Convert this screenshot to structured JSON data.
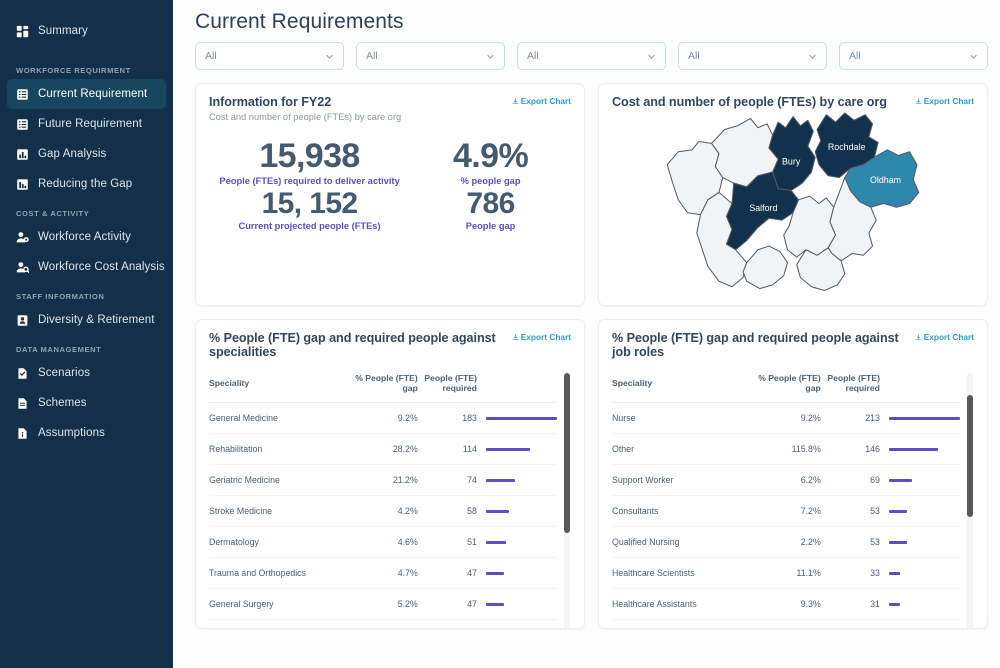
{
  "sidebar": {
    "items": [
      {
        "label": "Summary",
        "icon": "dashboard-icon",
        "type": "item",
        "active": false
      },
      {
        "label": "WORKFORCE REQUIRMENT",
        "type": "section"
      },
      {
        "label": "Current Requirement",
        "icon": "list-table-icon",
        "type": "item",
        "active": true
      },
      {
        "label": "Future Requirement",
        "icon": "list-table-icon",
        "type": "item",
        "active": false
      },
      {
        "label": "Gap Analysis",
        "icon": "chart-bar-icon",
        "type": "item",
        "active": false
      },
      {
        "label": "Reducing the Gap",
        "icon": "chart-decline-icon",
        "type": "item",
        "active": false
      },
      {
        "label": "COST &  ACTIVITY",
        "type": "section"
      },
      {
        "label": "Workforce Activity",
        "icon": "user-gear-icon",
        "type": "item",
        "active": false
      },
      {
        "label": "Workforce Cost Analysis",
        "icon": "user-search-icon",
        "type": "item",
        "active": false
      },
      {
        "label": "STAFF INFORMATION",
        "type": "section"
      },
      {
        "label": "Diversity & Retirement",
        "icon": "id-badge-icon",
        "type": "item",
        "active": false
      },
      {
        "label": "DATA MANAGEMENT",
        "type": "section"
      },
      {
        "label": "Scenarios",
        "icon": "file-check-icon",
        "type": "item",
        "active": false
      },
      {
        "label": "Schemes",
        "icon": "file-lines-icon",
        "type": "item",
        "active": false
      },
      {
        "label": "Assumptions",
        "icon": "file-info-icon",
        "type": "item",
        "active": false
      }
    ]
  },
  "header": {
    "title": "Current Requirements",
    "filters": [
      {
        "value": "All"
      },
      {
        "value": "All"
      },
      {
        "value": "All"
      },
      {
        "value": "All"
      },
      {
        "value": "All"
      }
    ]
  },
  "cards": {
    "info": {
      "title": "Information for FY22",
      "subtitle": "Cost and number of people (FTEs) by care org",
      "export_label": "Export Chart",
      "kpis": [
        {
          "value": "15,938",
          "label": "People (FTEs) required to deliver activity"
        },
        {
          "value": "4.9%",
          "label": "% people gap"
        },
        {
          "value": "15, 152",
          "label": "Current projected people (FTEs)"
        },
        {
          "value": "786",
          "label": "People gap"
        }
      ]
    },
    "map": {
      "title": "Cost and number of people (FTEs) by care org",
      "export_label": "Export Chart",
      "regions": [
        {
          "name": "Bury",
          "color": "#12314d"
        },
        {
          "name": "Rochdale",
          "color": "#12314d"
        },
        {
          "name": "Oldham",
          "color": "#2e87ad"
        },
        {
          "name": "Salford",
          "color": "#12314d"
        }
      ],
      "inactive_color": "#f2f3f5"
    },
    "specialities": {
      "title": "% People (FTE) gap and required people against specialities",
      "export_label": "Export Chart",
      "columns": [
        "Speciality",
        "% People (FTE) gap",
        "People (FTE) required",
        ""
      ],
      "rows": [
        {
          "name": "General Medicine",
          "gap": "9.2%",
          "required": "183",
          "bar": 100
        },
        {
          "name": "Rehabilitation",
          "gap": "28.2%",
          "required": "114",
          "bar": 62
        },
        {
          "name": "Geriatric Medicine",
          "gap": "21.2%",
          "required": "74",
          "bar": 41
        },
        {
          "name": "Stroke Medicine",
          "gap": "4.2%",
          "required": "58",
          "bar": 32
        },
        {
          "name": "Dermatology",
          "gap": "4.6%",
          "required": "51",
          "bar": 28
        },
        {
          "name": "Trauma and Orthopedics",
          "gap": "4.7%",
          "required": "47",
          "bar": 26
        },
        {
          "name": "General Surgery",
          "gap": "5.2%",
          "required": "47",
          "bar": 26
        }
      ]
    },
    "jobroles": {
      "title": "% People (FTE) gap and required people against job roles",
      "export_label": "Export Chart",
      "columns": [
        "Speciality",
        "% People (FTE) gap",
        "People (FTE) required",
        ""
      ],
      "rows": [
        {
          "name": "Nurse",
          "gap": "9.2%",
          "required": "213",
          "bar": 100
        },
        {
          "name": "Other",
          "gap": "115.8%",
          "required": "146",
          "bar": 69
        },
        {
          "name": "Support Worker",
          "gap": "6.2%",
          "required": "69",
          "bar": 33
        },
        {
          "name": "Consultants",
          "gap": "7.2%",
          "required": "53",
          "bar": 25
        },
        {
          "name": "Qualified Nursing",
          "gap": "2.2%",
          "required": "53",
          "bar": 25
        },
        {
          "name": "Healthcare Scientists",
          "gap": "11.1%",
          "required": "33",
          "bar": 16
        },
        {
          "name": "Healthcare Assistants",
          "gap": "9.3%",
          "required": "31",
          "bar": 15
        }
      ]
    }
  },
  "chart_data": [
    {
      "type": "bar",
      "title": "% People (FTE) gap and required people against specialities",
      "xlabel": "People (FTE) required",
      "ylabel": "Speciality",
      "categories": [
        "General Medicine",
        "Rehabilitation",
        "Geriatric Medicine",
        "Stroke Medicine",
        "Dermatology",
        "Trauma and Orthopedics",
        "General Surgery"
      ],
      "values": [
        183,
        114,
        74,
        58,
        51,
        47,
        47
      ],
      "secondary_series": {
        "name": "% People (FTE) gap",
        "values": [
          9.2,
          28.2,
          21.2,
          4.2,
          4.6,
          4.7,
          5.2
        ]
      }
    },
    {
      "type": "bar",
      "title": "% People (FTE) gap and required people against job roles",
      "xlabel": "People (FTE) required",
      "ylabel": "Speciality",
      "categories": [
        "Nurse",
        "Other",
        "Support Worker",
        "Consultants",
        "Qualified Nursing",
        "Healthcare Scientists",
        "Healthcare Assistants"
      ],
      "values": [
        213,
        146,
        69,
        53,
        53,
        33,
        31
      ],
      "secondary_series": {
        "name": "% People (FTE) gap",
        "values": [
          9.2,
          115.8,
          6.2,
          7.2,
          2.2,
          11.1,
          9.3
        ]
      }
    },
    {
      "type": "map",
      "title": "Cost and number of people (FTEs) by care org",
      "regions": [
        "Bury",
        "Rochdale",
        "Oldham",
        "Salford"
      ]
    }
  ]
}
